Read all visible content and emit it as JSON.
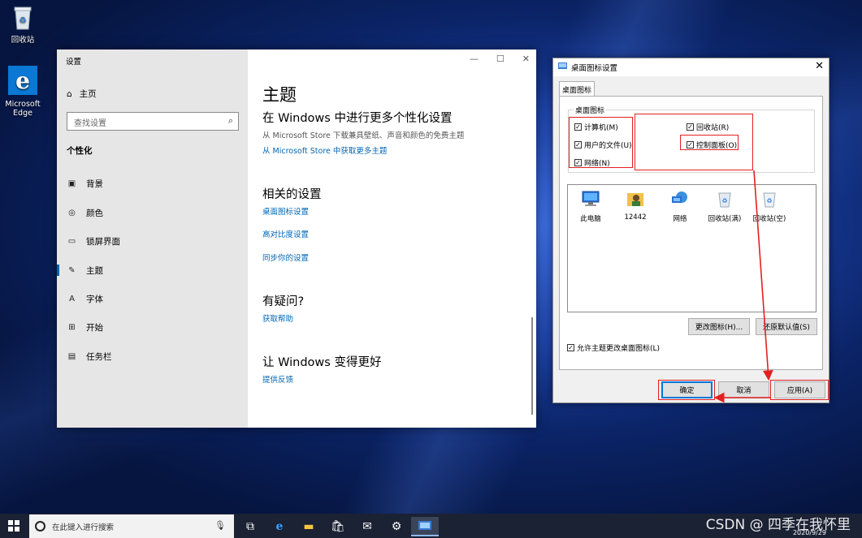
{
  "desktop": {
    "icons": [
      {
        "label": "回收站",
        "icon": "recycle-bin-icon"
      },
      {
        "label": "Microsoft Edge",
        "icon": "edge-icon"
      }
    ]
  },
  "settings": {
    "window_title": "设置",
    "controls": {
      "minimize": "—",
      "maximize": "☐",
      "close": "✕"
    },
    "home": "主页",
    "search_placeholder": "查找设置",
    "section": "个性化",
    "nav": [
      {
        "label": "背景",
        "icon": "picture-icon"
      },
      {
        "label": "颜色",
        "icon": "palette-icon"
      },
      {
        "label": "锁屏界面",
        "icon": "lock-screen-icon"
      },
      {
        "label": "主题",
        "icon": "theme-icon",
        "active": true
      },
      {
        "label": "字体",
        "icon": "font-icon"
      },
      {
        "label": "开始",
        "icon": "start-icon"
      },
      {
        "label": "任务栏",
        "icon": "taskbar-icon"
      }
    ],
    "main": {
      "title": "主题",
      "more_heading": "在 Windows 中进行更多个性化设置",
      "more_desc": "从 Microsoft Store 下载兼具壁纸、声音和颜色的免费主题",
      "more_link": "从 Microsoft Store 中获取更多主题",
      "related_heading": "相关的设置",
      "related_links": [
        "桌面图标设置",
        "高对比度设置",
        "同步你的设置"
      ],
      "question_heading": "有疑问?",
      "question_link": "获取帮助",
      "improve_heading": "让 Windows 变得更好",
      "improve_link": "提供反馈"
    }
  },
  "dialog": {
    "title": "桌面图标设置",
    "tab": "桌面图标",
    "group_legend": "桌面图标",
    "checkboxes": [
      {
        "label": "计算机(M)",
        "checked": true
      },
      {
        "label": "用户的文件(U)",
        "checked": true
      },
      {
        "label": "网络(N)",
        "checked": true
      },
      {
        "label": "回收站(R)",
        "checked": true
      },
      {
        "label": "控制面板(O)",
        "checked": true
      }
    ],
    "icons": [
      {
        "label": "此电脑",
        "icon": "computer-icon"
      },
      {
        "label": "12442",
        "icon": "user-folder-icon"
      },
      {
        "label": "网络",
        "icon": "network-icon"
      },
      {
        "label": "回收站(满)",
        "icon": "recycle-bin-full-icon"
      },
      {
        "label": "回收站(空)",
        "icon": "recycle-bin-empty-icon"
      }
    ],
    "change_icon": "更改图标(H)...",
    "restore_default": "还原默认值(S)",
    "allow_themes": "允许主题更改桌面图标(L)",
    "ok": "确定",
    "cancel": "取消",
    "apply": "应用(A)",
    "highlight_color": "#e32020"
  },
  "taskbar": {
    "search_placeholder": "在此键入进行搜索",
    "date": "2020/9/29"
  },
  "watermark": "CSDN @ 四季在我怀里"
}
